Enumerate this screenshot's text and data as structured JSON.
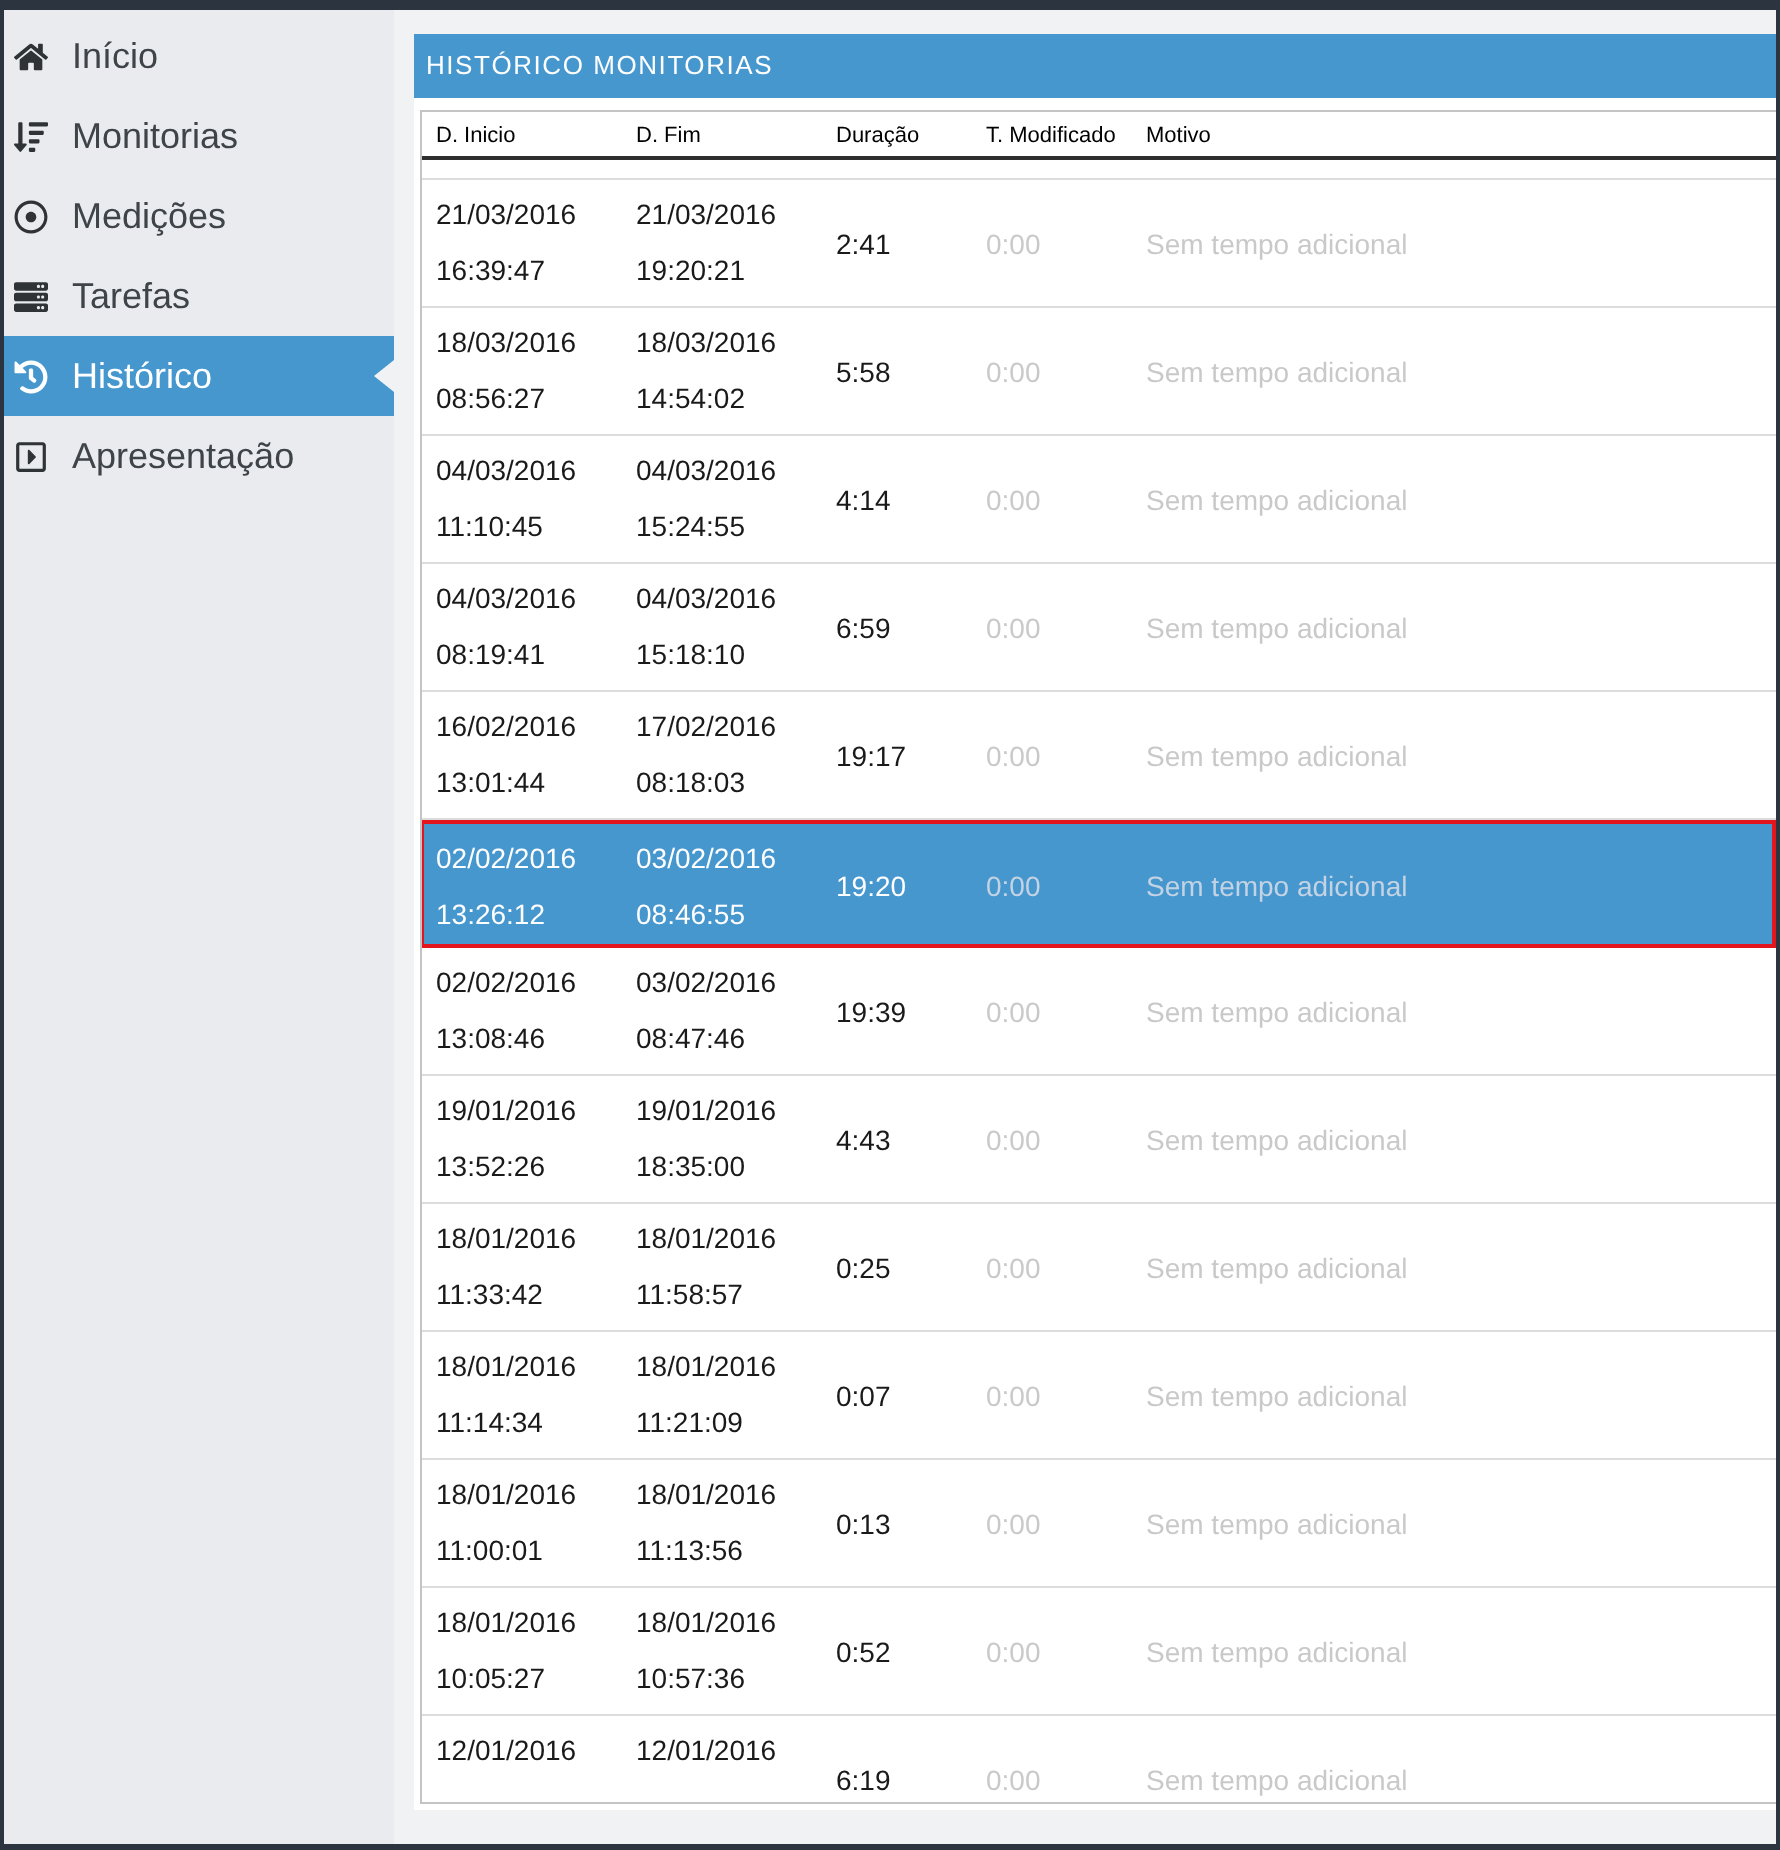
{
  "sidebar": {
    "items": [
      {
        "label": "Início",
        "selected": false
      },
      {
        "label": "Monitorias",
        "selected": false
      },
      {
        "label": "Medições",
        "selected": false
      },
      {
        "label": "Tarefas",
        "selected": false
      },
      {
        "label": "Histórico",
        "selected": true
      },
      {
        "label": "Apresentação",
        "selected": false
      }
    ]
  },
  "panel": {
    "title": "HISTÓRICO MONITORIAS",
    "table": {
      "columns": [
        "D. Inicio",
        "D. Fim",
        "Duração",
        "T. Modificado",
        "Motivo"
      ],
      "rows": [
        {
          "start_date": "21/03/2016",
          "start_time": "16:39:47",
          "end_date": "21/03/2016",
          "end_time": "19:20:21",
          "duration": "2:41",
          "modified": "0:00",
          "reason": "Sem tempo adicional",
          "selected": false
        },
        {
          "start_date": "18/03/2016",
          "start_time": "08:56:27",
          "end_date": "18/03/2016",
          "end_time": "14:54:02",
          "duration": "5:58",
          "modified": "0:00",
          "reason": "Sem tempo adicional",
          "selected": false
        },
        {
          "start_date": "04/03/2016",
          "start_time": "11:10:45",
          "end_date": "04/03/2016",
          "end_time": "15:24:55",
          "duration": "4:14",
          "modified": "0:00",
          "reason": "Sem tempo adicional",
          "selected": false
        },
        {
          "start_date": "04/03/2016",
          "start_time": "08:19:41",
          "end_date": "04/03/2016",
          "end_time": "15:18:10",
          "duration": "6:59",
          "modified": "0:00",
          "reason": "Sem tempo adicional",
          "selected": false
        },
        {
          "start_date": "16/02/2016",
          "start_time": "13:01:44",
          "end_date": "17/02/2016",
          "end_time": "08:18:03",
          "duration": "19:17",
          "modified": "0:00",
          "reason": "Sem tempo adicional",
          "selected": false
        },
        {
          "start_date": "02/02/2016",
          "start_time": "13:26:12",
          "end_date": "03/02/2016",
          "end_time": "08:46:55",
          "duration": "19:20",
          "modified": "0:00",
          "reason": "Sem tempo adicional",
          "selected": true
        },
        {
          "start_date": "02/02/2016",
          "start_time": "13:08:46",
          "end_date": "03/02/2016",
          "end_time": "08:47:46",
          "duration": "19:39",
          "modified": "0:00",
          "reason": "Sem tempo adicional",
          "selected": false
        },
        {
          "start_date": "19/01/2016",
          "start_time": "13:52:26",
          "end_date": "19/01/2016",
          "end_time": "18:35:00",
          "duration": "4:43",
          "modified": "0:00",
          "reason": "Sem tempo adicional",
          "selected": false
        },
        {
          "start_date": "18/01/2016",
          "start_time": "11:33:42",
          "end_date": "18/01/2016",
          "end_time": "11:58:57",
          "duration": "0:25",
          "modified": "0:00",
          "reason": "Sem tempo adicional",
          "selected": false
        },
        {
          "start_date": "18/01/2016",
          "start_time": "11:14:34",
          "end_date": "18/01/2016",
          "end_time": "11:21:09",
          "duration": "0:07",
          "modified": "0:00",
          "reason": "Sem tempo adicional",
          "selected": false
        },
        {
          "start_date": "18/01/2016",
          "start_time": "11:00:01",
          "end_date": "18/01/2016",
          "end_time": "11:13:56",
          "duration": "0:13",
          "modified": "0:00",
          "reason": "Sem tempo adicional",
          "selected": false
        },
        {
          "start_date": "18/01/2016",
          "start_time": "10:05:27",
          "end_date": "18/01/2016",
          "end_time": "10:57:36",
          "duration": "0:52",
          "modified": "0:00",
          "reason": "Sem tempo adicional",
          "selected": false
        },
        {
          "start_date": "12/01/2016",
          "end_date": "12/01/2016",
          "duration": "6:19",
          "modified": "0:00",
          "reason": "Sem tempo adicional",
          "selected": false
        }
      ]
    }
  }
}
